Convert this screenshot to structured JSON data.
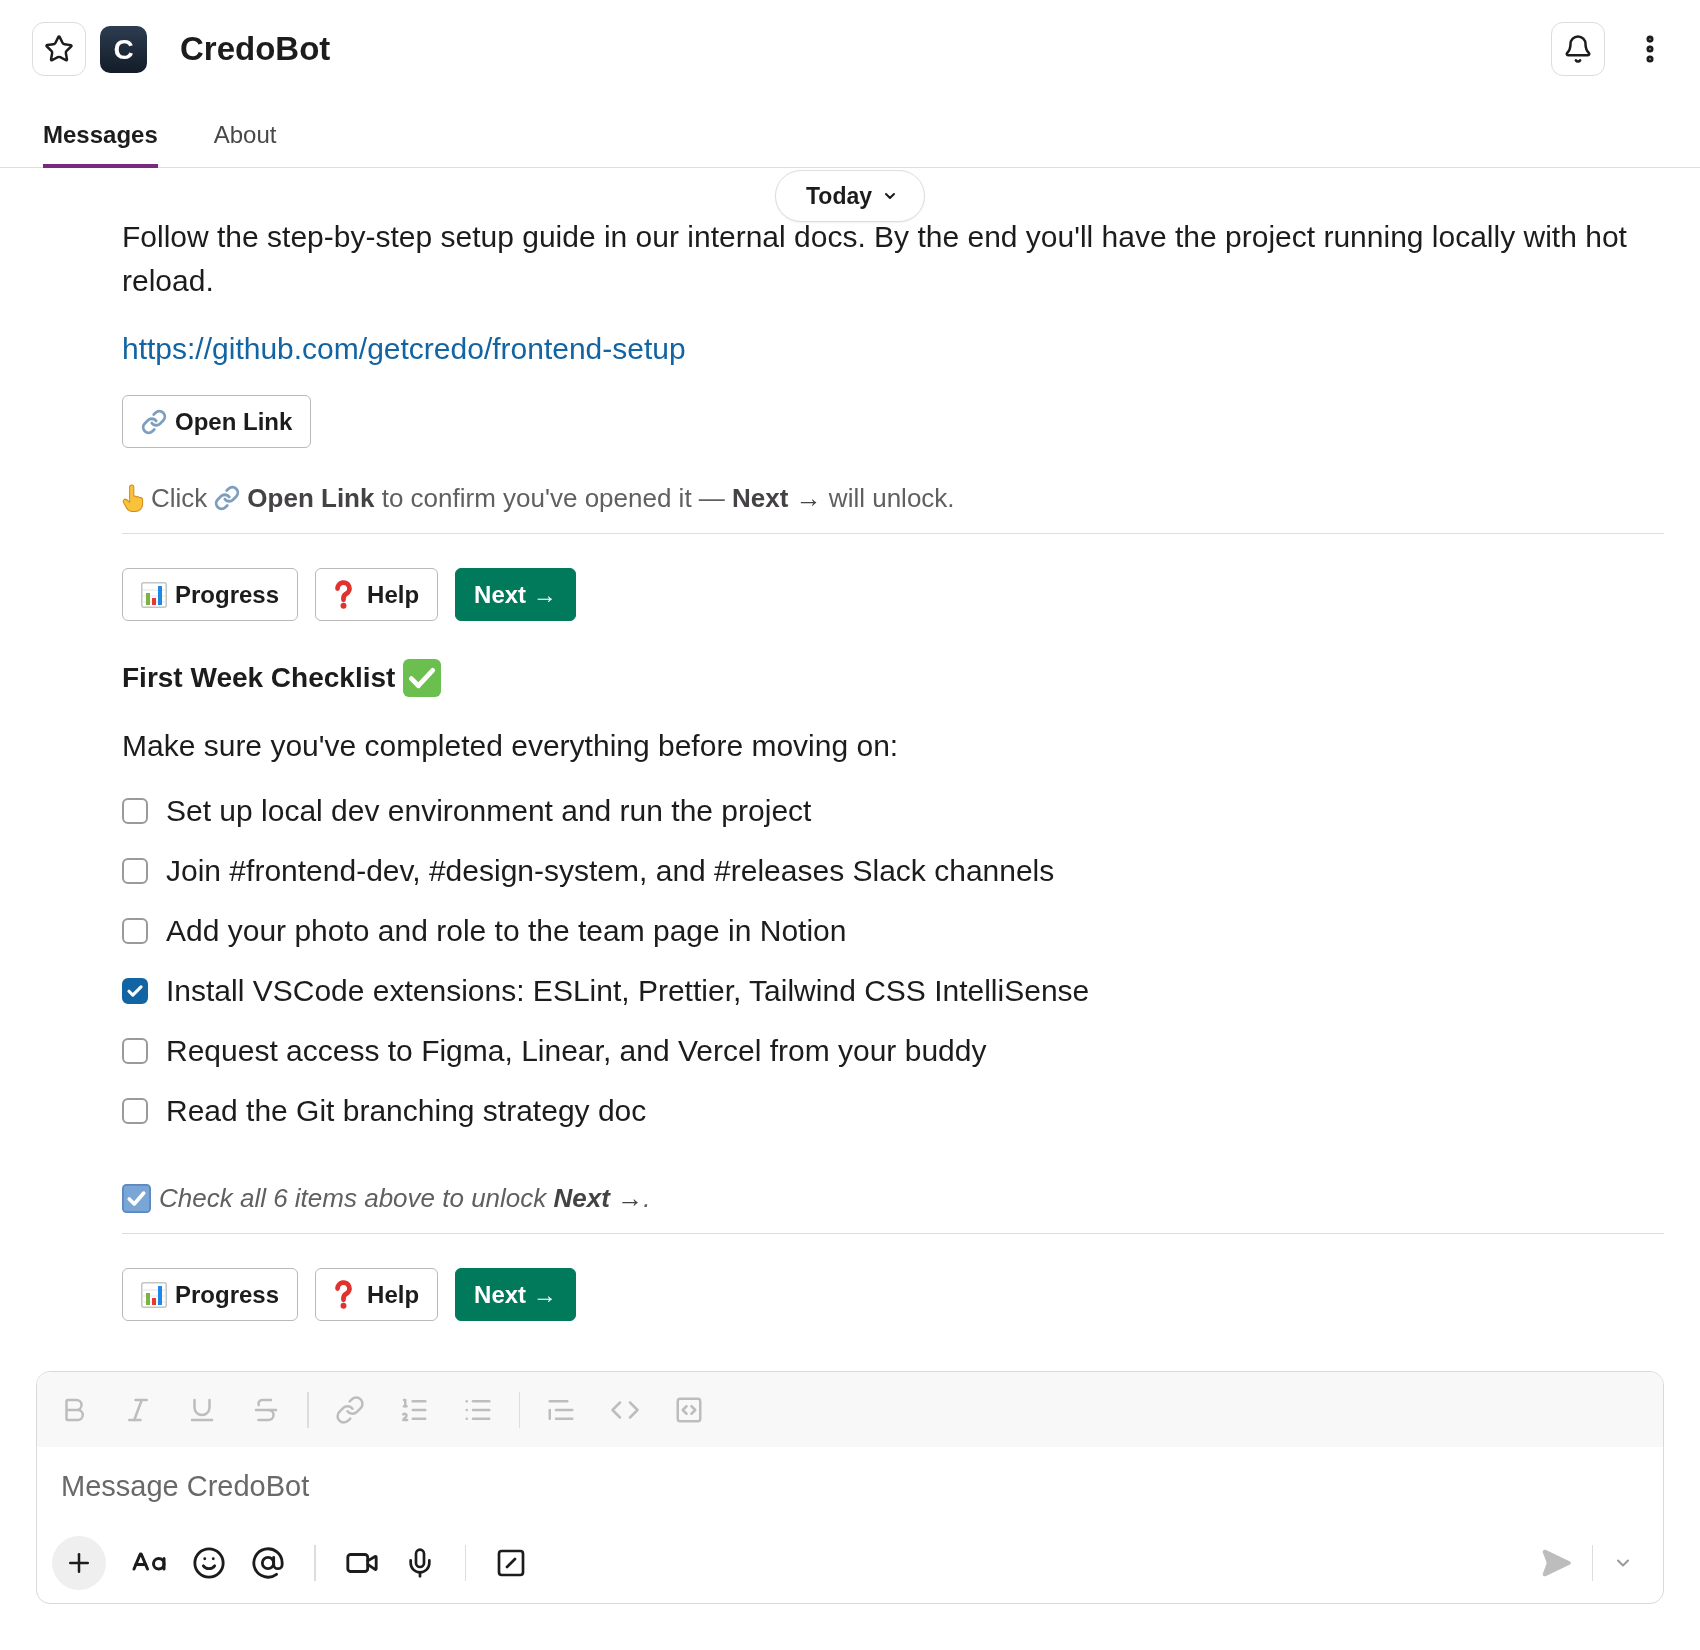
{
  "header": {
    "logo_letter": "C",
    "title": "CredoBot"
  },
  "tabs": [
    {
      "label": "Messages",
      "selected": true
    },
    {
      "label": "About",
      "selected": false
    }
  ],
  "date_divider": {
    "label": "Today"
  },
  "blocks": [
    {
      "kind": "paragraph",
      "text": "Follow the step-by-step setup guide in our internal docs. By the end you'll have the project running locally with hot reload."
    },
    {
      "kind": "link",
      "text": "https://github.com/getcredo/frontend-setup"
    },
    {
      "kind": "link_button",
      "label": "Open Link"
    },
    {
      "kind": "hint",
      "lead": "Click",
      "text": "**Open Link** to confirm you've opened it — **Next →** will unlock."
    },
    {
      "kind": "actions",
      "buttons": [
        {
          "kind": "progress",
          "label": "Progress"
        },
        {
          "kind": "help",
          "label": "Help"
        },
        {
          "kind": "next",
          "label": "Next →"
        }
      ]
    },
    {
      "kind": "checklist",
      "title": "First Week Checklist",
      "intro": "Make sure you've completed everything before moving on:",
      "items": [
        {
          "label": "Set up local dev environment and run the project",
          "checked": false
        },
        {
          "label": "Join #frontend-dev, #design-system, and #releases Slack channels",
          "checked": false
        },
        {
          "label": "Add your photo and role to the team page in Notion",
          "checked": false
        },
        {
          "label": "Install VSCode extensions: ESLint, Prettier, Tailwind CSS IntelliSense",
          "checked": true
        },
        {
          "label": "Request access to Figma, Linear, and Vercel from your buddy",
          "checked": false
        },
        {
          "label": "Read the Git branching strategy doc",
          "checked": false
        }
      ]
    },
    {
      "kind": "note",
      "text": "Check all 6 items above to unlock **Next →**."
    },
    {
      "kind": "actions",
      "buttons": [
        {
          "kind": "progress",
          "label": "Progress"
        },
        {
          "kind": "help",
          "label": "Help"
        },
        {
          "kind": "next",
          "label": "Next →"
        }
      ]
    }
  ],
  "composer": {
    "placeholder": "Message CredoBot",
    "formatting_disabled": true,
    "send_disabled": true
  }
}
